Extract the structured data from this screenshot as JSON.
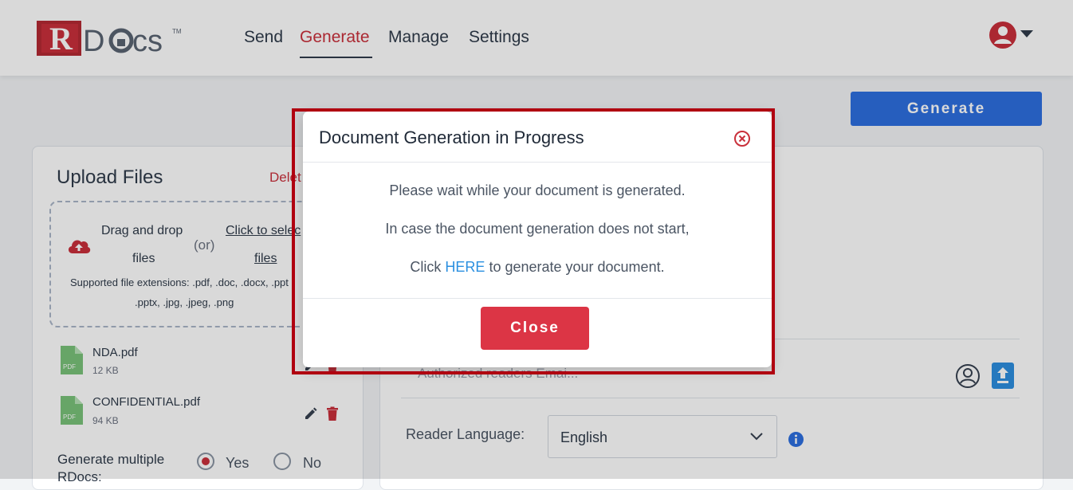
{
  "header": {
    "logo_text": "RDocs",
    "nav": [
      {
        "label": "Send"
      },
      {
        "label": "Generate"
      },
      {
        "label": "Manage"
      },
      {
        "label": "Settings"
      }
    ]
  },
  "toolbar": {
    "generate_label": "Generate"
  },
  "upload": {
    "title": "Upload Files",
    "delete_label": "Delet",
    "drag_line1": "Drag and drop",
    "drag_line2": "files",
    "or": "(or)",
    "click_line1": "Click to selec",
    "click_line2": "files",
    "ext_line1": "Supported file extensions: .pdf, .doc, .docx, .ppt",
    "ext_line2": ".pptx, .jpg, .jpeg, .png"
  },
  "files": [
    {
      "name": "NDA.pdf",
      "size": "12 KB",
      "badge": "PDF"
    },
    {
      "name": "CONFIDENTIAL.pdf",
      "size": "94 KB",
      "badge": "PDF"
    }
  ],
  "multiple": {
    "label": "Generate multiple RDocs:",
    "yes": "Yes",
    "no": "No",
    "selected": "Yes"
  },
  "recipients": {
    "authorized_placeholder": "Authorized readers Emai..."
  },
  "reader_language": {
    "label": "Reader Language:",
    "value": "English"
  },
  "modal": {
    "title": "Document Generation in Progress",
    "line1": "Please wait while your document is generated.",
    "line2": "In case the document generation does not start,",
    "line3_pre": "Click ",
    "line3_link": "HERE",
    "line3_post": " to generate your document.",
    "close_label": "Close"
  },
  "colors": {
    "brand_red": "#c9303b",
    "primary_blue": "#2d6fe0",
    "danger": "#dc3545",
    "link_blue": "#2a8fe0",
    "highlight_border": "#b00010"
  }
}
